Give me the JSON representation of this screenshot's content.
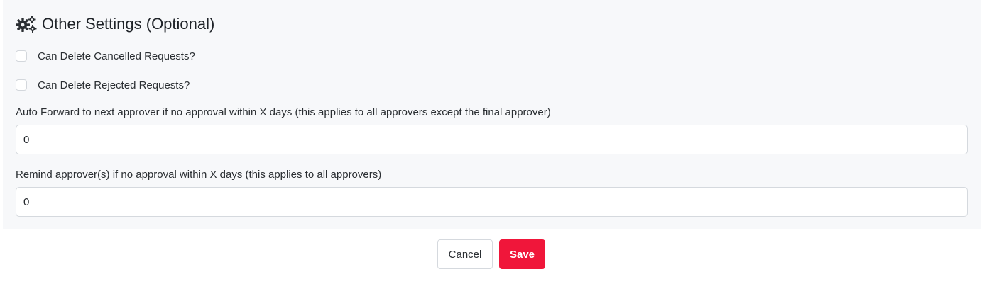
{
  "section": {
    "title": "Other Settings (Optional)",
    "icon": "cogs-icon"
  },
  "checkboxes": [
    {
      "label": "Can Delete Cancelled Requests?",
      "checked": false
    },
    {
      "label": "Can Delete Rejected Requests?",
      "checked": false
    }
  ],
  "fields": {
    "auto_forward": {
      "label": "Auto Forward to next approver if no approval within X days (this applies to all approvers except the final approver)",
      "value": "0"
    },
    "remind": {
      "label": "Remind approver(s) if no approval within X days (this applies to all approvers)",
      "value": "0"
    }
  },
  "actions": {
    "cancel_label": "Cancel",
    "save_label": "Save"
  },
  "colors": {
    "accent": "#f0163a",
    "panel_bg": "#f7f8fa"
  }
}
